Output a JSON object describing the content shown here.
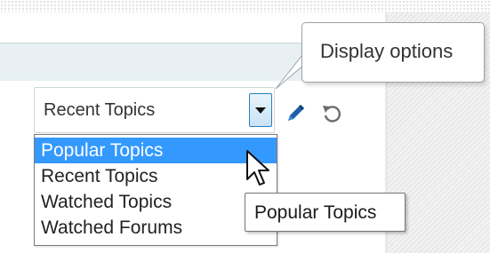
{
  "select": {
    "selected_value": "Recent Topics",
    "options": [
      "Popular Topics",
      "Recent Topics",
      "Watched Topics",
      "Watched Forums"
    ],
    "highlighted_option": "Popular Topics"
  },
  "tooltip": {
    "text": "Popular Topics"
  },
  "callout": {
    "text": "Display options"
  },
  "icons": {
    "edit": "pencil-icon",
    "reset": "reset-icon",
    "dropdown": "chevron-down-icon",
    "cursor": "mouse-cursor-icon"
  },
  "colors": {
    "highlight": "#3399ff",
    "header_band": "#e8f0f4",
    "accent_blue": "#2a7fbf"
  }
}
